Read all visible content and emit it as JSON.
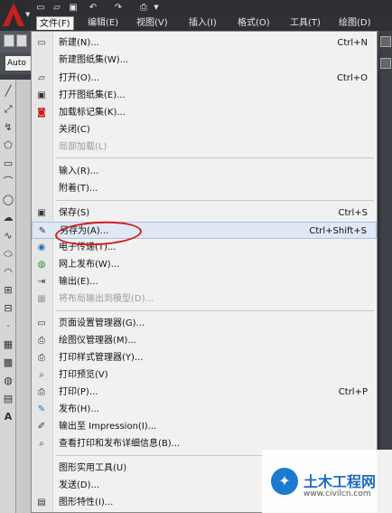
{
  "menubar": {
    "items": [
      {
        "label": "文件(F)"
      },
      {
        "label": "编辑(E)"
      },
      {
        "label": "视图(V)"
      },
      {
        "label": "插入(I)"
      },
      {
        "label": "格式(O)"
      },
      {
        "label": "工具(T)"
      },
      {
        "label": "绘图(D)"
      }
    ]
  },
  "toolbar": {
    "autosnap_value": "Auto"
  },
  "icons": {
    "app": "autocad-logo-icon",
    "new": "new-file-icon",
    "open": "folder-open-icon",
    "save": "save-icon",
    "undo": "undo-icon",
    "redo": "redo-icon",
    "print": "printer-icon"
  },
  "accent": "#c4201e",
  "annotation_color": "#d21c1c",
  "file_menu": {
    "new": {
      "label": "新建(N)...",
      "shortcut": "Ctrl+N"
    },
    "new_sheetset": {
      "label": "新建图纸集(W)..."
    },
    "open": {
      "label": "打开(O)...",
      "shortcut": "Ctrl+O"
    },
    "open_sheetset": {
      "label": "打开图纸集(E)..."
    },
    "load_markup": {
      "label": "加载标记集(K)..."
    },
    "close": {
      "label": "关闭(C)"
    },
    "partial_load": {
      "label": "局部加载(L)"
    },
    "import": {
      "label": "输入(R)..."
    },
    "attach": {
      "label": "附着(T)..."
    },
    "save": {
      "label": "保存(S)",
      "shortcut": "Ctrl+S"
    },
    "save_as": {
      "label": "另存为(A)...",
      "shortcut": "Ctrl+Shift+S"
    },
    "etransmit": {
      "label": "电子传递(T)..."
    },
    "publish_web": {
      "label": "网上发布(W)..."
    },
    "export": {
      "label": "输出(E)..."
    },
    "export_layout": {
      "label": "将布局输出到模型(D)..."
    },
    "page_setup": {
      "label": "页面设置管理器(G)..."
    },
    "plotter_mgr": {
      "label": "绘图仪管理器(M)..."
    },
    "plotstyle_mgr": {
      "label": "打印样式管理器(Y)..."
    },
    "plot_preview": {
      "label": "打印预览(V)"
    },
    "plot": {
      "label": "打印(P)...",
      "shortcut": "Ctrl+P"
    },
    "publish": {
      "label": "发布(H)..."
    },
    "export_impression": {
      "label": "输出至 Impression(I)..."
    },
    "plot_details": {
      "label": "查看打印和发布详细信息(B)..."
    },
    "drawing_utils": {
      "label": "图形实用工具(U)"
    },
    "send": {
      "label": "发送(D)..."
    },
    "drawing_props": {
      "label": "图形特性(I)..."
    }
  },
  "watermark": {
    "title": "土木工程网",
    "url": "www.civilcn.com"
  }
}
